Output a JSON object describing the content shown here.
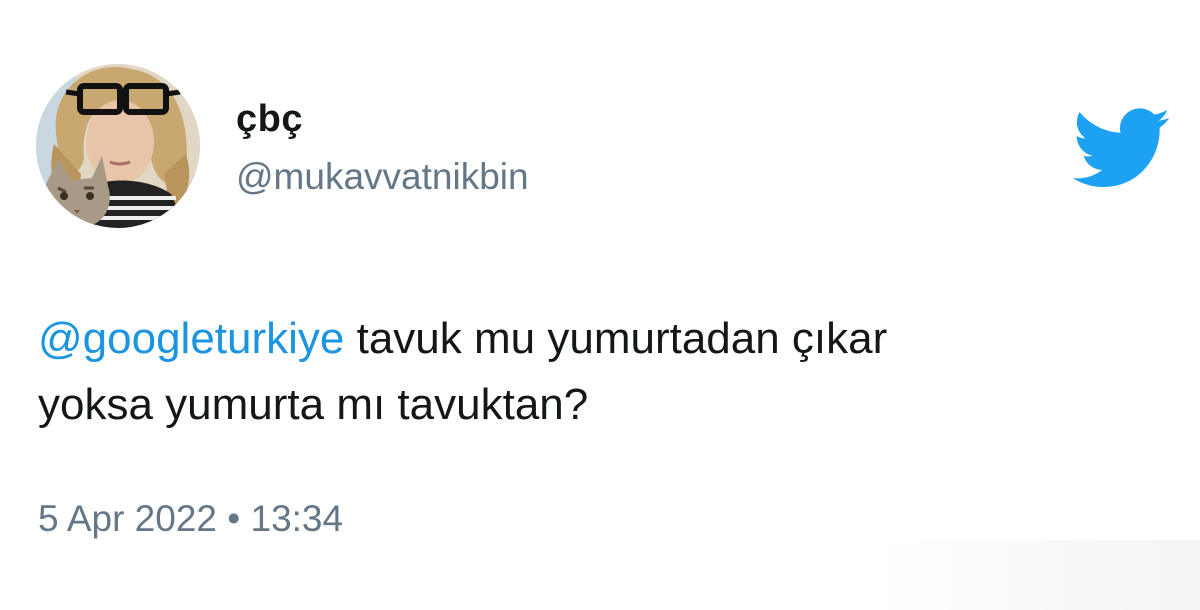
{
  "user": {
    "display_name": "çbç",
    "handle": "@mukavvatnikbin",
    "avatar": "profile-photo"
  },
  "brand": {
    "icon": "twitter-bird-icon",
    "color": "#1da1f2"
  },
  "tweet": {
    "mention": "@googleturkiye",
    "text_line1": " tavuk mu yumurtadan çıkar",
    "text_line2": "yoksa yumurta mı tavuktan?",
    "timestamp": "5 Apr 2022 • 13:34"
  },
  "colors": {
    "mention": "#1b95e0",
    "secondary_text": "#657786",
    "primary_text": "#14171a"
  }
}
